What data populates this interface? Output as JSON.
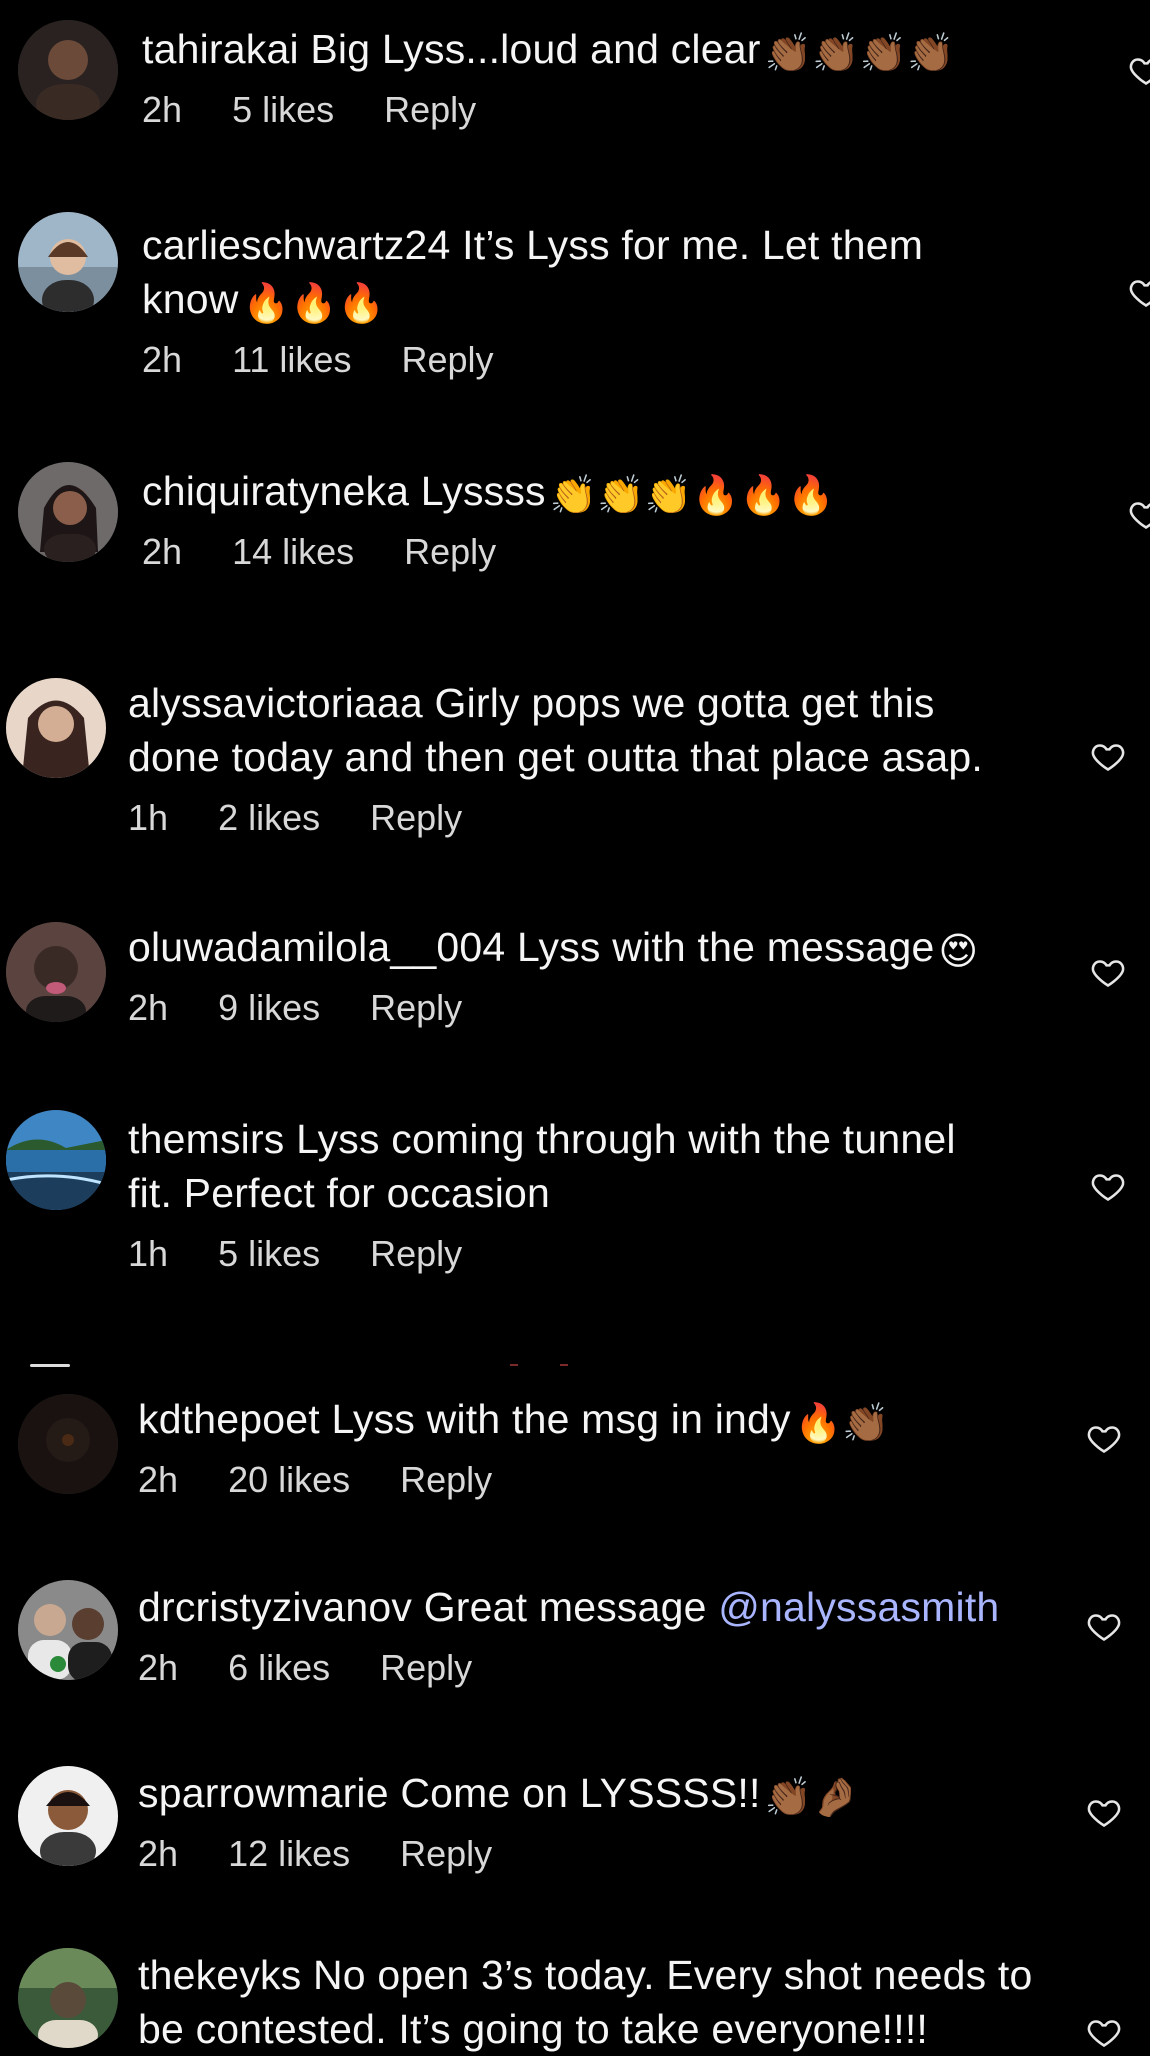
{
  "comments": [
    {
      "username": "tahirakai",
      "text": "Big Lyss...loud and clear",
      "emoji": "👏🏾👏🏾👏🏾👏🏾",
      "time": "2h",
      "likes": "5 likes",
      "reply": "Reply",
      "avatar_color": "#6b4a3a"
    },
    {
      "username": "carlieschwartz24",
      "text": "It’s Lyss for me. Let them know",
      "emoji": "🔥🔥🔥",
      "time": "2h",
      "likes": "11 likes",
      "reply": "Reply",
      "avatar_color": "#9fb6c8"
    },
    {
      "username": "chiquiratyneka",
      "text": "Lyssss",
      "emoji": "👏👏👏🔥🔥🔥",
      "time": "2h",
      "likes": "14 likes",
      "reply": "Reply",
      "avatar_color": "#4a3a3a"
    },
    {
      "username": "alyssavictoriaaa",
      "text": "Girly pops we gotta get this done today and then get outta that place asap.",
      "emoji": "",
      "time": "1h",
      "likes": "2 likes",
      "reply": "Reply",
      "avatar_color": "#c9a58c"
    },
    {
      "username": "oluwadamilola__004",
      "text": "Lyss with the message",
      "emoji": "😍",
      "time": "2h",
      "likes": "9 likes",
      "reply": "Reply",
      "avatar_color": "#3a2a26"
    },
    {
      "username": "themsirs",
      "text": "Lyss coming through with the tunnel fit. Perfect for occasion",
      "emoji": "",
      "time": "1h",
      "likes": "5 likes",
      "reply": "Reply",
      "avatar_color": "#2a6fa8"
    },
    {
      "username": "kdthepoet",
      "text": "Lyss with the msg in indy",
      "emoji": "🔥👏🏾",
      "time": "2h",
      "likes": "20 likes",
      "reply": "Reply",
      "avatar_color": "#241a16"
    },
    {
      "username": "drcristyzivanov",
      "text": "Great message",
      "mention": "@nalyssasmith",
      "emoji": "",
      "time": "2h",
      "likes": "6 likes",
      "reply": "Reply",
      "avatar_color": "#7a7a7a"
    },
    {
      "username": "sparrowmarie",
      "text": "Come on LYSSSS!!",
      "emoji": "👏🏾🤌🏾",
      "time": "2h",
      "likes": "12 likes",
      "reply": "Reply",
      "avatar_color": "#8a5a3a"
    },
    {
      "username": "thekeyks",
      "text": "No open 3’s today. Every shot needs to be contested. It’s going to take everyone!!!!",
      "emoji": "",
      "time": "",
      "likes": "",
      "reply": "",
      "avatar_color": "#5a4a3a"
    }
  ],
  "colors": {
    "background": "#000000",
    "text": "#f5f5f5",
    "meta": "#d8d8d8",
    "mention": "#a9b6ff"
  },
  "icons": {
    "like": "heart-outline-icon"
  }
}
